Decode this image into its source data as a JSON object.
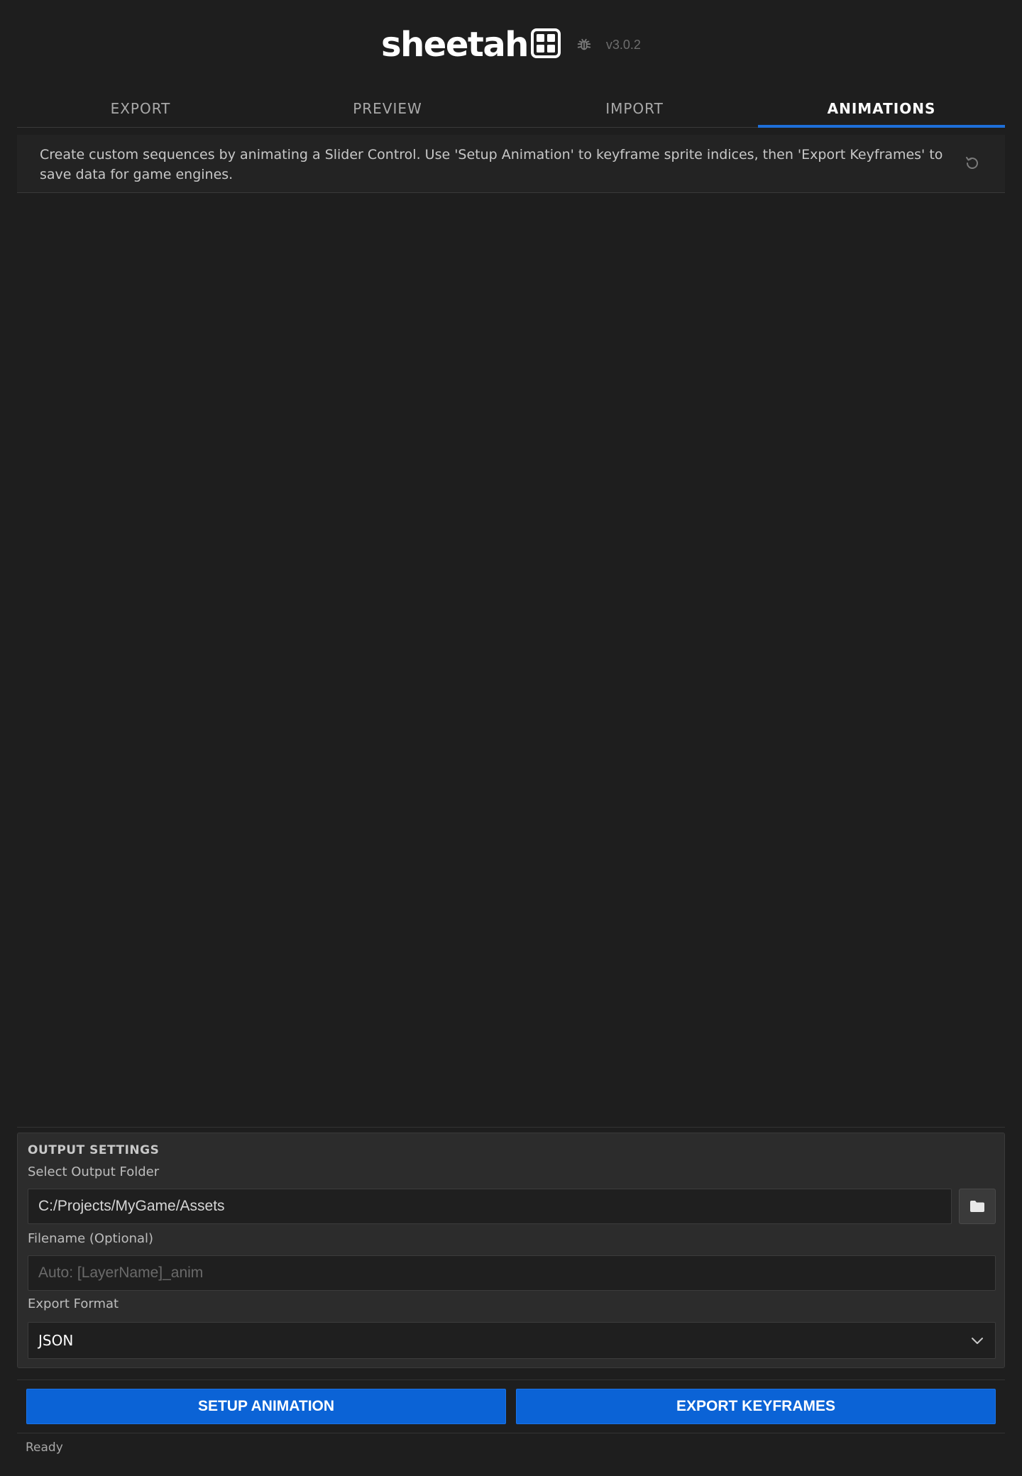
{
  "header": {
    "logo_text": "sheetah",
    "version": "v3.0.2"
  },
  "tabs": [
    {
      "label": "EXPORT",
      "active": false
    },
    {
      "label": "PREVIEW",
      "active": false
    },
    {
      "label": "IMPORT",
      "active": false
    },
    {
      "label": "ANIMATIONS",
      "active": true
    }
  ],
  "info": {
    "text": "Create custom sequences by animating a Slider Control. Use 'Setup Animation' to keyframe sprite indices, then 'Export Keyframes' to save data for game engines."
  },
  "output_settings": {
    "title": "OUTPUT SETTINGS",
    "folder_label": "Select Output Folder",
    "folder_value": "C:/Projects/MyGame/Assets",
    "filename_label": "Filename (Optional)",
    "filename_value": "",
    "filename_placeholder": "Auto: [LayerName]_anim",
    "format_label": "Export Format",
    "format_value": "JSON"
  },
  "actions": {
    "setup_label": "SETUP ANIMATION",
    "export_label": "EXPORT KEYFRAMES"
  },
  "status": {
    "text": "Ready"
  },
  "colors": {
    "background": "#1e1e1e",
    "accent": "#1e6fd9",
    "button": "#0b63d6"
  },
  "icons": {
    "logo": "grid-logo-icon",
    "debug": "bug-icon",
    "reset": "reset-icon",
    "folder": "folder-icon",
    "dropdown": "chevron-down-icon"
  }
}
